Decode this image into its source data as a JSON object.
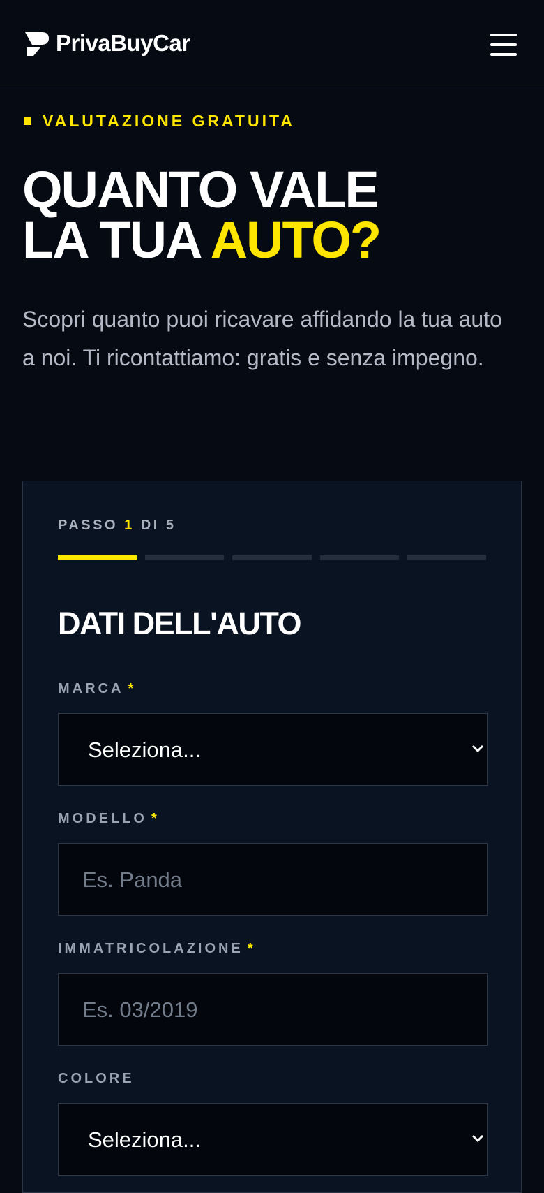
{
  "header": {
    "brand": "PrivaBuyCar"
  },
  "hero": {
    "eyebrow": "VALUTAZIONE GRATUITA",
    "title_line1": "QUANTO VALE",
    "title_line2_prefix": "LA TUA ",
    "title_line2_accent": "AUTO?",
    "lead": "Scopri quanto puoi ricavare affidando la tua auto a noi. Ti ricontattiamo: gratis e senza impegno."
  },
  "form": {
    "step_prefix": "PASSO",
    "step_current": "1",
    "step_suffix": "DI 5",
    "progress": {
      "current": 1,
      "total": 5
    },
    "section_title": "DATI DELL'AUTO",
    "required_mark": "*",
    "fields": {
      "marca": {
        "label": "MARCA",
        "value": "Seleziona..."
      },
      "modello": {
        "label": "MODELLO",
        "placeholder": "Es. Panda"
      },
      "immatricolazione": {
        "label": "IMMATRICOLAZIONE",
        "placeholder": "Es. 03/2019"
      },
      "colore": {
        "label": "COLORE",
        "value": "Seleziona..."
      }
    }
  },
  "icons": {
    "logo": "brand-logo-icon",
    "menu": "hamburger-menu-icon",
    "select": "chevron-down-icon"
  },
  "colors": {
    "accent": "#ffe600",
    "background": "#060a12",
    "card": "#0a1322"
  }
}
